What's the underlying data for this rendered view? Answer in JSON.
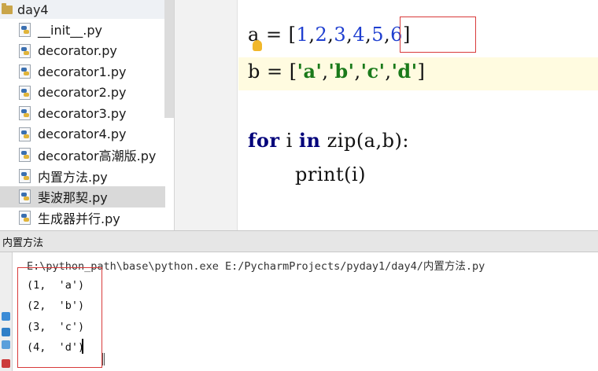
{
  "project": {
    "folder": "day4",
    "files": [
      {
        "name": "__init__.py",
        "selected": false
      },
      {
        "name": "decorator.py",
        "selected": false
      },
      {
        "name": "decorator1.py",
        "selected": false
      },
      {
        "name": "decorator2.py",
        "selected": false
      },
      {
        "name": "decorator3.py",
        "selected": false
      },
      {
        "name": "decorator4.py",
        "selected": false
      },
      {
        "name": "decorator高潮版.py",
        "selected": false
      },
      {
        "name": "内置方法.py",
        "selected": false
      },
      {
        "name": "斐波那契.py",
        "selected": true
      },
      {
        "name": "生成器并行.py",
        "selected": false
      }
    ]
  },
  "editor": {
    "line_a": {
      "prefix": "a = [",
      "nums": [
        "1",
        "2",
        "3",
        "4",
        "5",
        "6"
      ],
      "suffix": "]"
    },
    "line_b": {
      "prefix": "b = [",
      "items": [
        "'a'",
        "'b'",
        "'c'",
        "'d'"
      ],
      "suffix": "]"
    },
    "line_for": {
      "kw1": "for",
      "mid1": " i ",
      "kw2": "in",
      "rest": " zip(a,b):"
    },
    "line_print": "print(i)"
  },
  "run": {
    "tab_title": "内置方法",
    "command": "E:\\python_path\\base\\python.exe E:/PycharmProjects/pyday1/day4/内置方法.py",
    "output": [
      "(1,  'a')",
      "(2,  'b')",
      "(3,  'c')",
      "(4,  'd')"
    ]
  },
  "colors": {
    "highlight_box": "#d83a3a",
    "keyword": "#00007a",
    "number": "#1f3fd0",
    "string": "#1a7a1a"
  },
  "icons": {
    "folder": "folder-icon",
    "python_file": "python-file-icon",
    "lightbulb": "lightbulb-icon"
  }
}
